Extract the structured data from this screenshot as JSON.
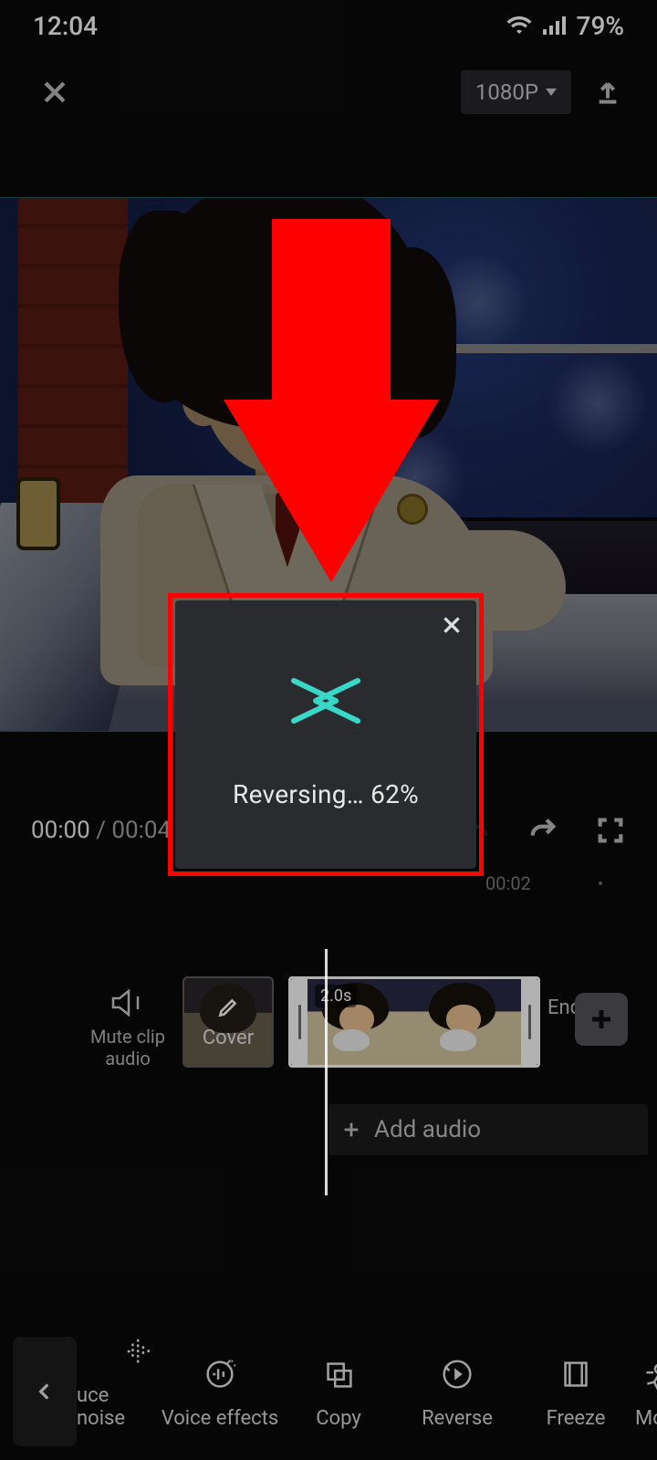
{
  "status": {
    "time": "12:04",
    "battery": "79%"
  },
  "topbar": {
    "resolution": "1080P"
  },
  "playback": {
    "current": "00:00",
    "total": "00:04"
  },
  "ruler": {
    "mark": "00:02"
  },
  "timeline": {
    "mute_line1": "Mute clip",
    "mute_line2": "audio",
    "cover_label": "Cover",
    "clip_duration": "2.0s",
    "ending_label": "Ending",
    "add_audio_label": "Add audio"
  },
  "dialog": {
    "text_prefix": "Reversing… ",
    "percent": "62%"
  },
  "tools": {
    "reduce_noise": "uce noise",
    "voice_effects": "Voice effects",
    "copy": "Copy",
    "reverse": "Reverse",
    "freeze": "Freeze",
    "motion": "Motion l"
  }
}
